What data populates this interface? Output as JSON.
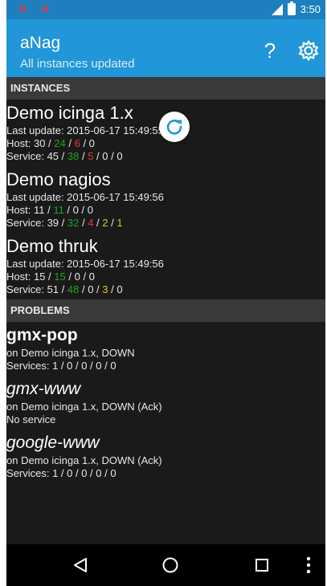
{
  "status_bar": {
    "notification_icons": [
      "N",
      "N"
    ],
    "time": "3:50"
  },
  "app_bar": {
    "title": "aNag",
    "subtitle": "All instances updated",
    "help_label": "?"
  },
  "sections": {
    "instances_header": "INSTANCES",
    "problems_header": "PROBLEMS"
  },
  "instances": [
    {
      "name": "Demo icinga 1.x",
      "last_update": "Last update: 2015-06-17 15:49:55",
      "host_label": "Host: ",
      "host": [
        "30",
        "24",
        "6",
        "0"
      ],
      "service_label": "Service: ",
      "service": [
        "45",
        "38",
        "5",
        "0",
        "0"
      ]
    },
    {
      "name": "Demo nagios",
      "last_update": "Last update: 2015-06-17 15:49:56",
      "host_label": "Host: ",
      "host": [
        "11",
        "11",
        "0",
        "0"
      ],
      "service_label": "Service: ",
      "service": [
        "39",
        "32",
        "4",
        "2",
        "1"
      ]
    },
    {
      "name": "Demo thruk",
      "last_update": "Last update: 2015-06-17 15:49:56",
      "host_label": "Host: ",
      "host": [
        "15",
        "15",
        "0",
        "0"
      ],
      "service_label": "Service: ",
      "service": [
        "51",
        "48",
        "0",
        "3",
        "0"
      ]
    }
  ],
  "problems": [
    {
      "name": "gmx-pop",
      "detail": "on Demo icinga 1.x, DOWN",
      "services": "Services: 1 / 0 / 0 / 0 / 0",
      "acknowledged": false
    },
    {
      "name": "gmx-www",
      "detail": "on Demo icinga 1.x, DOWN (Ack)",
      "services": "No service",
      "acknowledged": true
    },
    {
      "name": "google-www",
      "detail": "on Demo icinga 1.x, DOWN (Ack)",
      "services": "Services: 1 / 0 / 0 / 0 / 0",
      "acknowledged": true
    }
  ],
  "colors": {
    "status_bar": "#1e7fbf",
    "app_bar": "#2196d8",
    "ok": "#21a321",
    "critical": "#e53935",
    "warning": "#e3c21a",
    "background": "#1a1a1a",
    "section_header": "#3a3a3a"
  },
  "icons": {
    "refresh": "refresh-icon",
    "settings": "gear-icon",
    "back": "back-icon",
    "home": "home-icon",
    "recents": "recents-icon",
    "overflow": "overflow-menu-icon"
  }
}
